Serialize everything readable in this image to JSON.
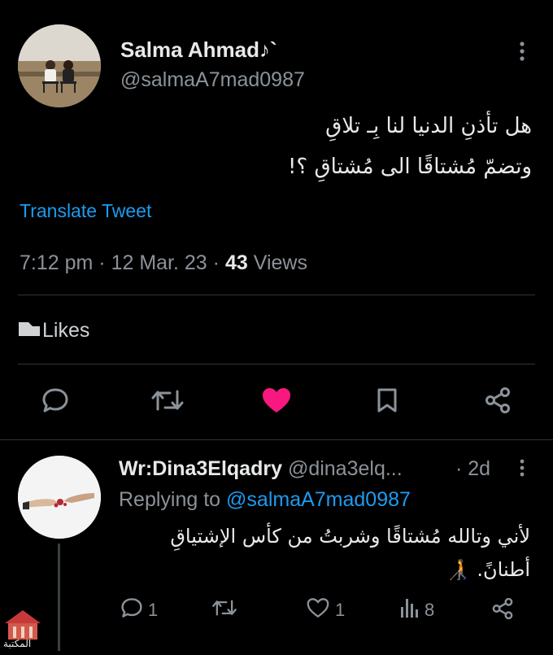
{
  "tweet": {
    "author_name": "Salma Ahmad♪`",
    "author_handle": "@salmaA7mad0987",
    "text_line1": "هل تأذنِ الدنيا لنا بِـ تلاقِ",
    "text_line2": "وتضمّ مُشتاقًا الى مُشتاقِ ؟!",
    "translate_label": "Translate Tweet",
    "time": "7:12 pm",
    "date": "12 Mar. 23",
    "views_count": "43",
    "views_label": "Views",
    "likes_label": "Likes",
    "separator": "·",
    "more_icon": "vertical-dots-icon"
  },
  "actions": {
    "reply_icon": "comment-icon",
    "retweet_icon": "retweet-icon",
    "like_icon": "heart-filled-icon",
    "bookmark_icon": "bookmark-icon",
    "share_icon": "share-icon",
    "like_color": "#f91880"
  },
  "reply": {
    "author_name": "Wr:Dina3Elqadry",
    "author_handle": "@dina3elq...",
    "age": "· 2d",
    "replying_to_label": "Replying to",
    "replying_to_handle": "@salmaA7mad0987",
    "text_line1": "لأني وتالله مُشتاقًا وشربتُ من كأس الإشتياقِ",
    "text_line2": "أطنانً.",
    "emoji": "🧑‍🦯",
    "reply_count": "1",
    "like_count": "1",
    "views_count": "8"
  },
  "watermark": {
    "text": "المكتبة"
  },
  "colors": {
    "background": "#000000",
    "text": "#e7e9ea",
    "muted": "#8b9299",
    "link": "#1d9bf0",
    "divider": "#2f3336"
  }
}
